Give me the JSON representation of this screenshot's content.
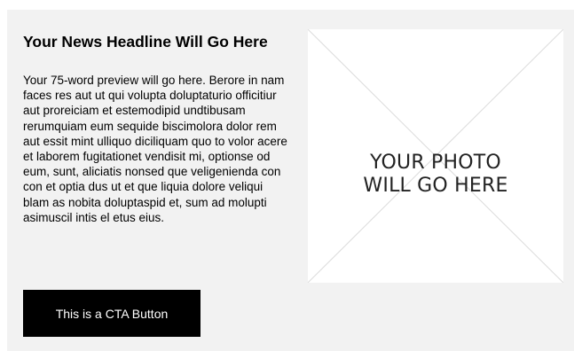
{
  "article": {
    "headline": "Your News Headline Will Go Here",
    "preview": "Your 75-word preview will go here. Berore in nam faces res aut ut qui volupta doluptaturio officitiur aut proreiciam et estemodipid undtibusam rerumquiam eum sequide biscimolora dolor rem aut essit mint ulliquo diciliquam quo to volor acere et laborem fugitationet vendisit mi, optionse od eum, sunt, aliciatis nonsed que veligenienda con con et optia dus ut et que liquia dolore veliqui blam as nobita doluptaspid et, sum ad molupti asimuscil intis el etus eius.",
    "cta_label": "This is a CTA Button"
  },
  "photo": {
    "placeholder_line1": "YOUR PHOTO",
    "placeholder_line2": "WILL GO HERE"
  },
  "colors": {
    "card_background": "#f2f2f2",
    "button_background": "#000000",
    "button_text": "#ffffff",
    "placeholder_cross": "#dcdcdc"
  }
}
